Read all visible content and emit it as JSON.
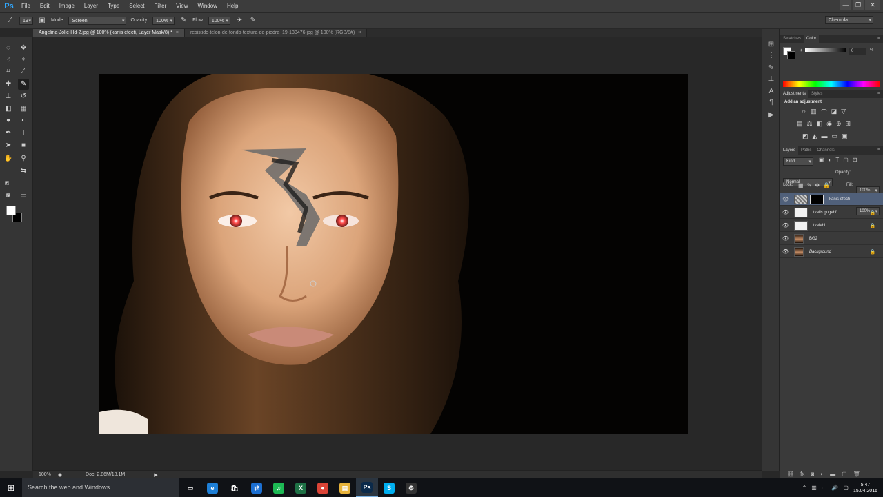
{
  "app": {
    "logo": "Ps"
  },
  "menu": [
    "File",
    "Edit",
    "Image",
    "Layer",
    "Type",
    "Select",
    "Filter",
    "View",
    "Window",
    "Help"
  ],
  "window_controls": {
    "minimize": "—",
    "restore": "❐",
    "close": "✕"
  },
  "options": {
    "brush_size": "19",
    "mode_label": "Mode:",
    "mode_value": "Screen",
    "opacity_label": "Opacity:",
    "opacity_value": "100%",
    "flow_label": "Flow:",
    "flow_value": "100%",
    "workspace": "Chembla"
  },
  "tabs": [
    {
      "title": "Angelina-Jolie-Hd-2.jpg @ 100% (kanis efecti, Layer Mask/8) *",
      "active": true
    },
    {
      "title": "resistido-telon-de-fondo-textura-de-piedra_19-133476.jpg @ 100% (RGB/8#)",
      "active": false
    }
  ],
  "status": {
    "zoom": "100%",
    "doc_info": "Doc: 2,86M/18,1M"
  },
  "colors": {
    "foreground": "#ffffff",
    "background": "#000000",
    "accent": "#31a8ff"
  },
  "panels": {
    "swatches_tab": "Swatches",
    "color_tab": "Color",
    "color_channel": "K",
    "color_value": "0",
    "color_unit": "%",
    "adjustments_tab": "Adjustments",
    "styles_tab": "Styles",
    "add_adjustment": "Add an adjustment",
    "layers_tab": "Layers",
    "paths_tab": "Paths",
    "channels_tab": "Channels",
    "kind_filter": "Kind",
    "blend_mode": "Normal",
    "opacity_label": "Opacity:",
    "opacity_value": "100%",
    "lock_label": "Lock:",
    "fill_label": "Fill:",
    "fill_value": "100%"
  },
  "layers": [
    {
      "name": "kanis efecti",
      "thumb": "pattern",
      "mask": true,
      "selected": true,
      "italic": false,
      "locked": false
    },
    {
      "name": "tvalis gugebi\\",
      "thumb": "blank",
      "mask": false,
      "selected": false,
      "italic": false,
      "locked": true
    },
    {
      "name": "tvalebi",
      "thumb": "blank",
      "mask": false,
      "selected": false,
      "italic": false,
      "locked": true
    },
    {
      "name": "BG2",
      "thumb": "face",
      "mask": false,
      "selected": false,
      "italic": false,
      "locked": false
    },
    {
      "name": "Background",
      "thumb": "face",
      "mask": false,
      "selected": false,
      "italic": true,
      "locked": true
    }
  ],
  "taskbar": {
    "search_placeholder": "Search the web and Windows",
    "apps": [
      {
        "name": "task-view-icon",
        "glyph": "▭",
        "color": "#101216",
        "active": false
      },
      {
        "name": "edge-icon",
        "glyph": "e",
        "color": "#1e7fd6",
        "active": false
      },
      {
        "name": "store-icon",
        "glyph": "🛍",
        "color": "#101216",
        "active": false
      },
      {
        "name": "teamviewer-icon",
        "glyph": "⇄",
        "color": "#1c6fd1",
        "active": false
      },
      {
        "name": "spotify-icon",
        "glyph": "♫",
        "color": "#1db954",
        "active": false
      },
      {
        "name": "excel-icon",
        "glyph": "X",
        "color": "#1e7145",
        "active": false
      },
      {
        "name": "chrome-icon",
        "glyph": "●",
        "color": "#db4437",
        "active": false
      },
      {
        "name": "file-explorer-icon",
        "glyph": "▤",
        "color": "#e8b33a",
        "active": false
      },
      {
        "name": "photoshop-icon",
        "glyph": "Ps",
        "color": "#0b2a4a",
        "active": true
      },
      {
        "name": "skype-icon",
        "glyph": "S",
        "color": "#00aff0",
        "active": false
      },
      {
        "name": "steam-icon",
        "glyph": "⚙",
        "color": "#333",
        "active": false
      }
    ],
    "time": "5:47",
    "date": "15.04.2016"
  }
}
